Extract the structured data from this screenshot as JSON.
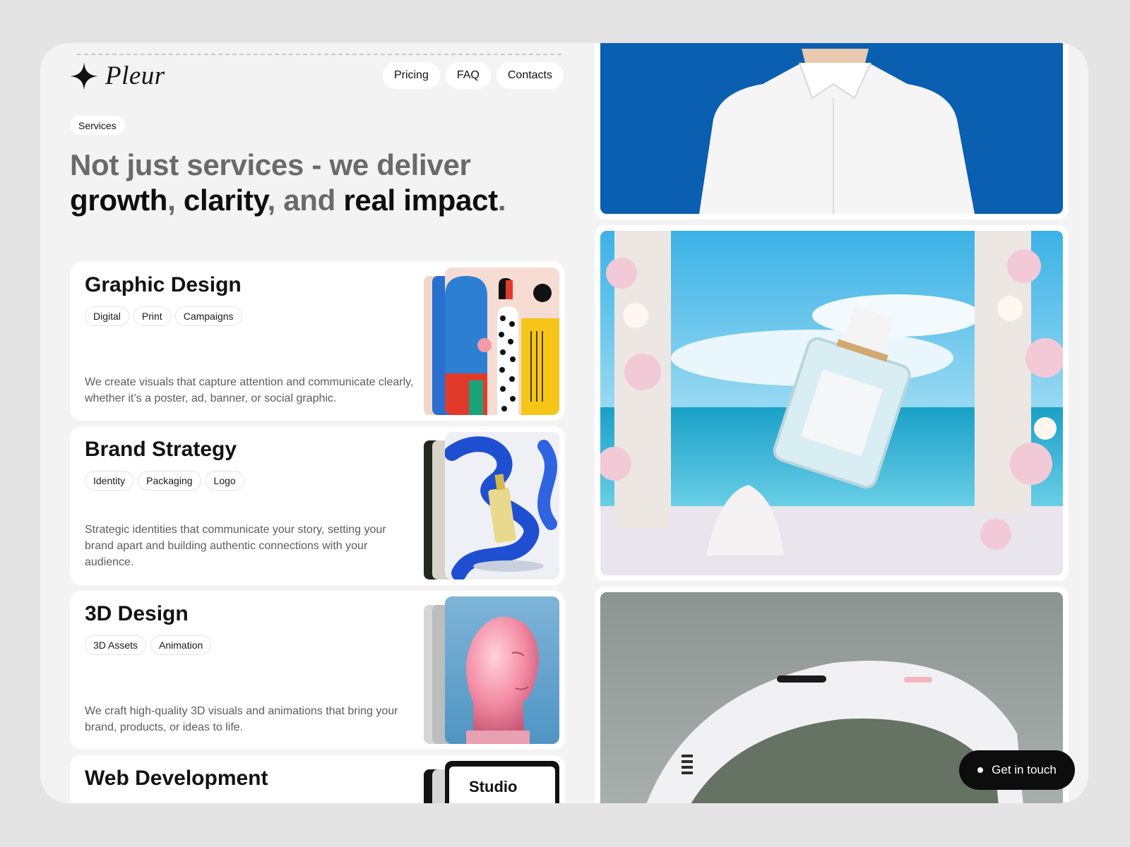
{
  "brand": {
    "name": "Pleur",
    "icon": "sparkle-star-icon"
  },
  "nav": {
    "items": [
      {
        "label": "Pricing"
      },
      {
        "label": "FAQ"
      },
      {
        "label": "Contacts"
      }
    ]
  },
  "section": {
    "badge": "Services"
  },
  "headline": {
    "part1": "Not just services - we deliver",
    "word_growth": "growth",
    "comma1": ",",
    "word_clarity": "clarity",
    "comma2": ",",
    "word_and": "and",
    "word_impact": "real impact",
    "period": "."
  },
  "services": [
    {
      "title": "Graphic Design",
      "tags": [
        "Digital",
        "Print",
        "Campaigns"
      ],
      "description": "We create visuals that capture attention and communicate clearly, whether it’s a poster, ad, banner, or social graphic."
    },
    {
      "title": "Brand Strategy",
      "tags": [
        "Identity",
        "Packaging",
        "Logo"
      ],
      "description": "Strategic identities that communicate your story, setting your brand apart and building authentic connections with your audience."
    },
    {
      "title": "3D Design",
      "tags": [
        "3D Assets",
        "Animation"
      ],
      "description": "We craft high-quality 3D visuals and animations that bring your brand, products, or ideas to life."
    },
    {
      "title": "Web Development",
      "thumb_text": "Studio"
    }
  ],
  "gallery": [
    {
      "subject": "white shirt on blue"
    },
    {
      "subject": "perfume bottle by the sea"
    },
    {
      "subject": "VR headset"
    }
  ],
  "cta": {
    "label": "Get in touch"
  },
  "colors": {
    "background": "#e4e4e4",
    "frame": "#f3f3f3",
    "cta": "#0d0d0d",
    "accent_blue": "#0a5fb0"
  }
}
